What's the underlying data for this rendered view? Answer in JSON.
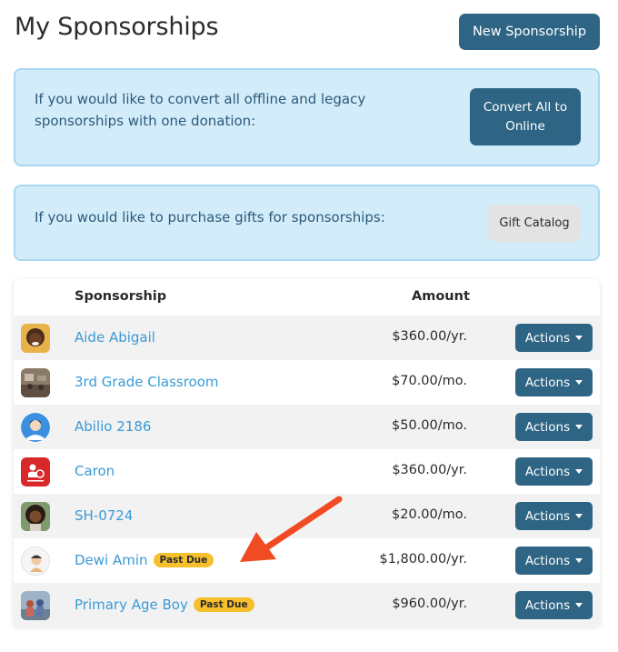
{
  "header": {
    "title": "My Sponsorships",
    "new_button": "New Sponsorship"
  },
  "convert_box": {
    "text": "If you would like to convert all offline and legacy sponsorships with one donation:",
    "button": "Convert All to Online"
  },
  "gift_box": {
    "text": "If you would like to purchase gifts for sponsorships:",
    "button": "Gift Catalog"
  },
  "table": {
    "columns": {
      "sponsorship": "Sponsorship",
      "amount": "Amount"
    },
    "rows": [
      {
        "name": "Aide Abigail",
        "amount": "$360.00/yr.",
        "badge": "",
        "actions": "Actions",
        "avatar_icon": "child-photo-icon"
      },
      {
        "name": "3rd Grade Classroom",
        "amount": "$70.00/mo.",
        "badge": "",
        "actions": "Actions",
        "avatar_icon": "classroom-photo-icon"
      },
      {
        "name": "Abilio 2186",
        "amount": "$50.00/mo.",
        "badge": "",
        "actions": "Actions",
        "avatar_icon": "person-avatar-icon"
      },
      {
        "name": "Caron",
        "amount": "$360.00/yr.",
        "badge": "",
        "actions": "Actions",
        "avatar_icon": "organization-logo-icon"
      },
      {
        "name": "SH-0724",
        "amount": "$20.00/mo.",
        "badge": "",
        "actions": "Actions",
        "avatar_icon": "child-photo-icon"
      },
      {
        "name": "Dewi Amin",
        "amount": "$1,800.00/yr.",
        "badge": "Past Due",
        "actions": "Actions",
        "avatar_icon": "child-illustration-icon"
      },
      {
        "name": "Primary Age Boy",
        "amount": "$960.00/yr.",
        "badge": "Past Due",
        "actions": "Actions",
        "avatar_icon": "group-photo-icon"
      }
    ]
  },
  "colors": {
    "primary": "#2e6585",
    "link": "#3a9ad6",
    "info_bg": "#d3ecfa",
    "badge": "#f6c02c",
    "arrow": "#f04b23"
  }
}
